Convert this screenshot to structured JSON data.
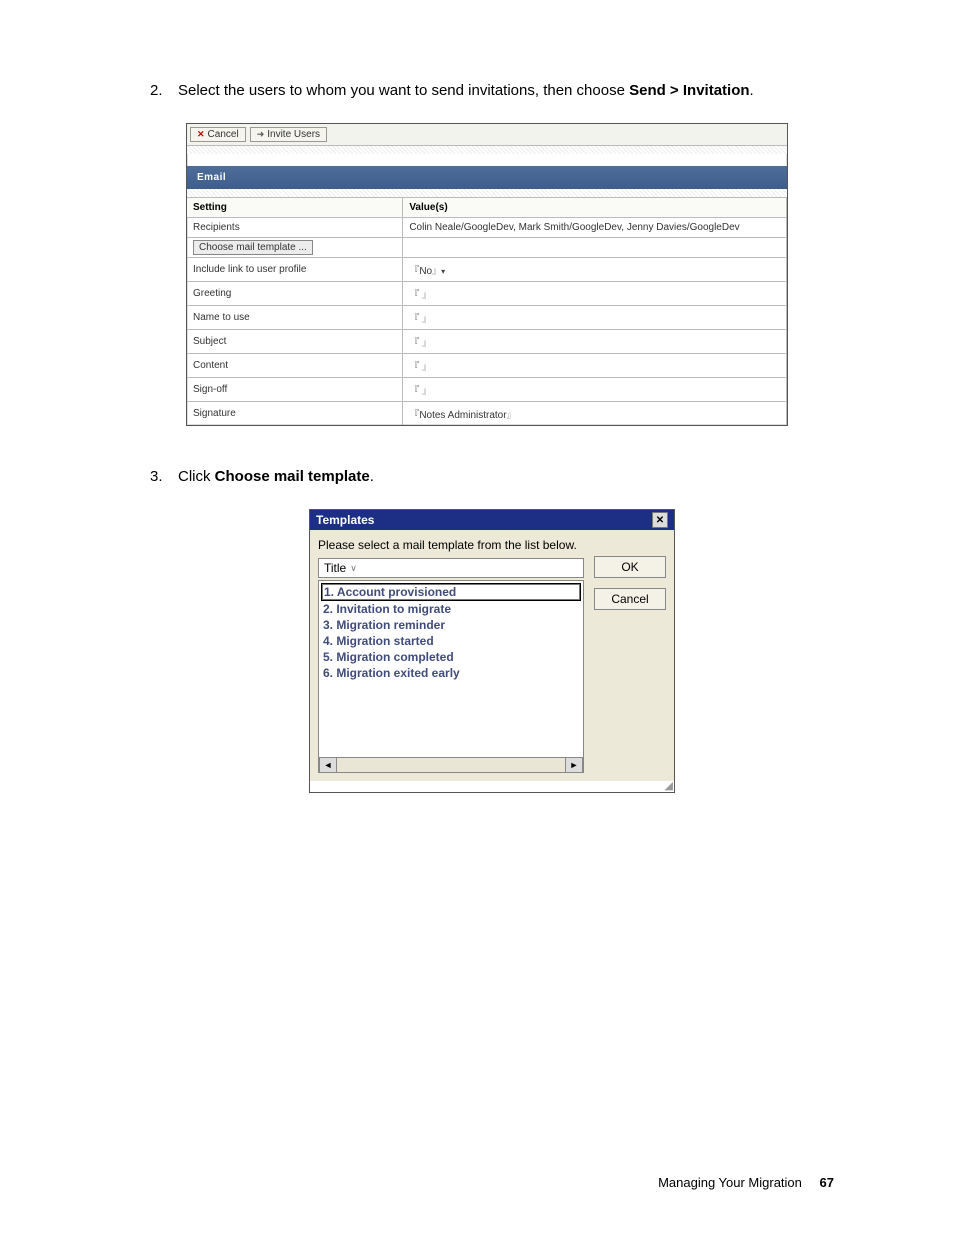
{
  "steps": {
    "num2": "2.",
    "text2_pre": "Select the users to whom you want to send invitations, then choose ",
    "text2_bold": "Send > Invitation",
    "text2_post": ".",
    "num3": "3.",
    "text3_pre": "Click ",
    "text3_bold": "Choose mail template",
    "text3_post": "."
  },
  "email_screenshot": {
    "toolbar": {
      "cancel": "Cancel",
      "invite": "Invite Users"
    },
    "section_title": "Email",
    "headers": {
      "setting": "Setting",
      "value": "Value(s)"
    },
    "rows": [
      {
        "label": "Recipients",
        "value": "Colin Neale/GoogleDev, Mark Smith/GoogleDev, Jenny Davies/GoogleDev"
      }
    ],
    "template_btn": "Choose mail template ...",
    "rows2": [
      {
        "label": "Include link to user profile",
        "value": "No",
        "has_dropdown": true
      },
      {
        "label": "Greeting",
        "value": ""
      },
      {
        "label": "Name to use",
        "value": ""
      },
      {
        "label": "Subject",
        "value": ""
      },
      {
        "label": "Content",
        "value": ""
      },
      {
        "label": "Sign-off",
        "value": ""
      },
      {
        "label": "Signature",
        "value": "Notes Administrator"
      }
    ]
  },
  "dialog": {
    "title": "Templates",
    "instruction": "Please select a mail template from the list below.",
    "title_col": "Title",
    "items": [
      "1. Account provisioned",
      "2. Invitation to migrate",
      "3. Migration reminder",
      "4. Migration started",
      "5. Migration completed",
      "6. Migration exited early"
    ],
    "ok": "OK",
    "cancel": "Cancel"
  },
  "footer": {
    "section": "Managing Your Migration",
    "page": "67"
  }
}
